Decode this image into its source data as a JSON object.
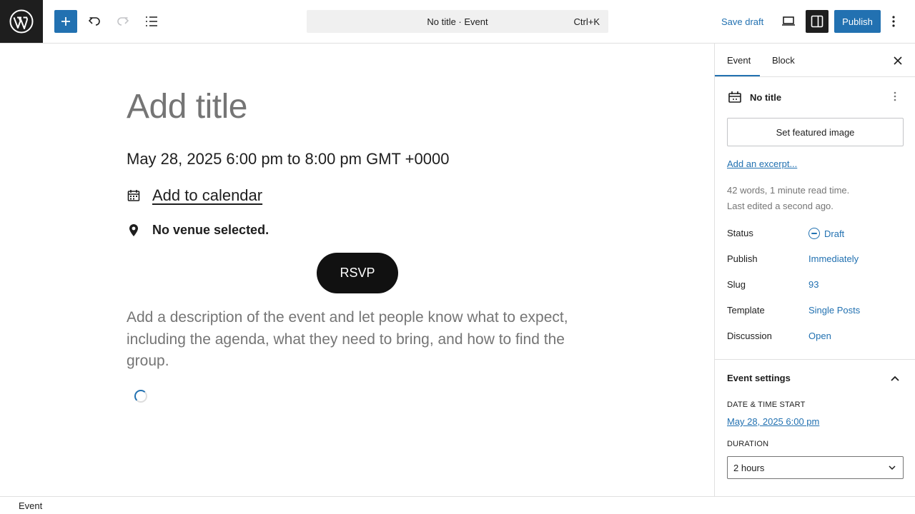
{
  "topbar": {
    "command_title": "No title · Event",
    "command_shortcut": "Ctrl+K",
    "save_draft_label": "Save draft",
    "publish_label": "Publish"
  },
  "editor": {
    "title_placeholder": "Add title",
    "event_datetime": "May 28, 2025 6:00 pm to 8:00 pm GMT +0000",
    "add_to_calendar": "Add to calendar",
    "venue": "No venue selected.",
    "rsvp_label": "RSVP",
    "description_placeholder": "Add a description of the event and let people know what to expect, including the agenda, what they need to bring, and how to find the group."
  },
  "sidebar": {
    "tabs": [
      {
        "label": "Event",
        "active": true
      },
      {
        "label": "Block",
        "active": false
      }
    ],
    "post_title": "No title",
    "featured_image_label": "Set featured image",
    "excerpt_link": "Add an excerpt...",
    "word_count": "42 words, 1 minute read time.",
    "last_edited": "Last edited a second ago.",
    "meta": [
      {
        "label": "Status",
        "value": "Draft"
      },
      {
        "label": "Publish",
        "value": "Immediately"
      },
      {
        "label": "Slug",
        "value": "93"
      },
      {
        "label": "Template",
        "value": "Single Posts"
      },
      {
        "label": "Discussion",
        "value": "Open"
      }
    ],
    "event_settings": {
      "title": "Event settings",
      "date_time_start_label": "DATE & TIME START",
      "date_time_start_value": "May 28, 2025 6:00 pm",
      "duration_label": "DURATION",
      "duration_value": "2 hours"
    }
  },
  "footer": {
    "breadcrumb": "Event"
  },
  "colors": {
    "accent": "#2271b1",
    "dark": "#1e1e1e",
    "muted": "#757575"
  }
}
